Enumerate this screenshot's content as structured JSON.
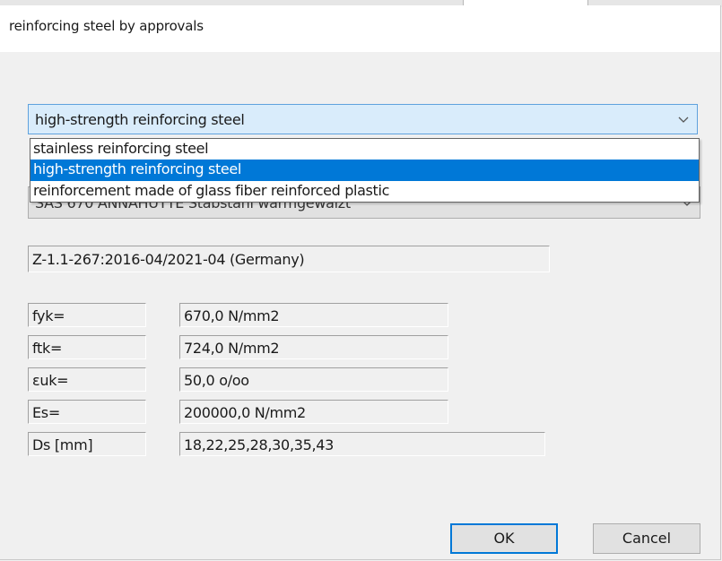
{
  "window": {
    "title": "reinforcing steel by approvals"
  },
  "steel_type": {
    "selected": "high-strength reinforcing steel",
    "options": [
      "stainless reinforcing steel",
      "high-strength reinforcing steel",
      "reinforcement made of glass fiber reinforced plastic"
    ],
    "chevron_icon": "chevron-down-icon"
  },
  "product": {
    "value": "SAS 670 ANNAHUTTE Stabstahl warmgewalzt",
    "chevron_icon": "chevron-down-icon"
  },
  "approval": "Z-1.1-267:2016-04/2021-04  (Germany)",
  "properties": [
    {
      "label": "fyk=",
      "value": "670,0 N/mm2"
    },
    {
      "label": "ftk=",
      "value": "724,0 N/mm2"
    },
    {
      "label": "ɛuk=",
      "value": "50,0 o/oo"
    },
    {
      "label": "Es=",
      "value": "200000,0 N/mm2"
    },
    {
      "label": "Ds [mm]",
      "value": "18,22,25,28,30,35,43"
    }
  ],
  "buttons": {
    "ok": "OK",
    "cancel": "Cancel"
  },
  "colors": {
    "accent": "#0078d7",
    "combo_focus_bg": "#d9ecfb",
    "dialog_bg": "#f0f0f0"
  }
}
